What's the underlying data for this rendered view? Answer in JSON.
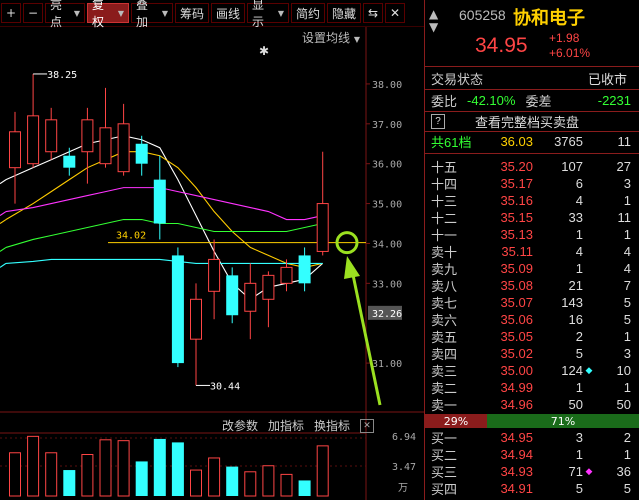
{
  "toolbar": {
    "items": [
      {
        "label": "+"
      },
      {
        "label": "−"
      },
      {
        "label": "亮点",
        "arrow": true
      },
      {
        "label": "复权",
        "arrow": true,
        "active": true
      },
      {
        "label": "叠加",
        "arrow": true
      },
      {
        "label": "筹码"
      },
      {
        "label": "画线"
      },
      {
        "label": "显示",
        "arrow": true
      },
      {
        "label": "简约"
      },
      {
        "label": "隐藏"
      },
      {
        "label": "⇆"
      },
      {
        "label": "✕"
      }
    ]
  },
  "chart": {
    "settings_link": "设置均线",
    "settings_arrow": "▼",
    "star": "✱",
    "price_axis": [
      "38.00",
      "37.00",
      "36.00",
      "35.00",
      "34.00",
      "33.00",
      "32.26",
      "31.00"
    ],
    "high_label": "38.25",
    "low_label": "30.44",
    "line_label": "34.02",
    "vol_axis": [
      "6.94",
      "3.47"
    ],
    "volume_unit": "万",
    "ind_links": [
      "改参数",
      "加指标",
      "换指标"
    ],
    "ind_close": "✕"
  },
  "chart_data": {
    "type": "candlestick",
    "candles": [
      {
        "o": 35.9,
        "c": 36.8,
        "h": 37.3,
        "l": 35.0,
        "up": true
      },
      {
        "o": 36.0,
        "c": 37.2,
        "h": 38.25,
        "l": 35.9,
        "up": true
      },
      {
        "o": 36.3,
        "c": 37.1,
        "h": 37.4,
        "l": 36.1,
        "up": true
      },
      {
        "o": 35.9,
        "c": 36.2,
        "h": 36.4,
        "l": 35.7,
        "up": false
      },
      {
        "o": 36.3,
        "c": 37.1,
        "h": 37.4,
        "l": 35.5,
        "up": true
      },
      {
        "o": 36.0,
        "c": 36.9,
        "h": 37.9,
        "l": 35.9,
        "up": true
      },
      {
        "o": 35.8,
        "c": 37.0,
        "h": 37.5,
        "l": 35.7,
        "up": true
      },
      {
        "o": 36.5,
        "c": 36.0,
        "h": 36.7,
        "l": 35.7,
        "up": false
      },
      {
        "o": 35.6,
        "c": 34.5,
        "h": 36.2,
        "l": 34.1,
        "up": false
      },
      {
        "o": 33.7,
        "c": 31.0,
        "h": 33.9,
        "l": 30.9,
        "up": false
      },
      {
        "o": 31.6,
        "c": 32.6,
        "h": 33.0,
        "l": 30.44,
        "up": true
      },
      {
        "o": 32.8,
        "c": 33.6,
        "h": 34.1,
        "l": 32.1,
        "up": true
      },
      {
        "o": 33.2,
        "c": 32.2,
        "h": 33.4,
        "l": 32.0,
        "up": false
      },
      {
        "o": 32.3,
        "c": 33.0,
        "h": 33.5,
        "l": 31.6,
        "up": true
      },
      {
        "o": 32.6,
        "c": 33.2,
        "h": 33.3,
        "l": 31.9,
        "up": true
      },
      {
        "o": 33.0,
        "c": 33.4,
        "h": 33.6,
        "l": 32.8,
        "up": true
      },
      {
        "o": 33.0,
        "c": 33.7,
        "h": 33.9,
        "l": 32.8,
        "up": false
      },
      {
        "o": 33.8,
        "c": 35.0,
        "h": 36.3,
        "l": 33.7,
        "up": true
      }
    ],
    "ma": [
      {
        "name": "MA5",
        "color": "#ffffff",
        "values": [
          35.6,
          35.9,
          36.1,
          36.3,
          36.5,
          36.6,
          36.7,
          36.6,
          36.4,
          35.6,
          34.7,
          33.8,
          33.0,
          32.6,
          32.9,
          33.0,
          33.1,
          33.5
        ]
      },
      {
        "name": "MA10",
        "color": "#ffcc00",
        "values": [
          34.6,
          35.0,
          35.3,
          35.6,
          35.9,
          36.1,
          36.3,
          36.3,
          36.2,
          35.9,
          35.4,
          34.8,
          34.3,
          33.9,
          33.7,
          33.5,
          33.4,
          33.5
        ]
      },
      {
        "name": "MA20",
        "color": "#ff33ff",
        "values": [
          34.8,
          34.9,
          35.0,
          35.1,
          35.2,
          35.3,
          35.4,
          35.4,
          35.4,
          35.3,
          35.2,
          35.1,
          35.0,
          34.9,
          34.8,
          34.6,
          34.6,
          34.7
        ]
      },
      {
        "name": "MA30",
        "color": "#33ff33",
        "values": [
          33.9,
          34.1,
          34.2,
          34.3,
          34.4,
          34.5,
          34.6,
          34.6,
          34.5,
          34.5,
          34.4,
          34.3,
          34.3,
          34.3,
          34.3,
          34.3,
          34.4,
          34.5
        ]
      },
      {
        "name": "MA60",
        "color": "#33ffff",
        "values": [
          33.5,
          33.55,
          33.6,
          33.6,
          33.6,
          33.6,
          33.6,
          33.6,
          33.6,
          33.55,
          33.5,
          33.5,
          33.5,
          33.5,
          33.5,
          33.5,
          33.5,
          33.5
        ]
      }
    ],
    "volumes": [
      5.0,
      6.9,
      5.0,
      3.0,
      4.8,
      6.5,
      6.4,
      4.0,
      6.6,
      6.2,
      3.0,
      4.4,
      3.4,
      2.8,
      3.5,
      2.5,
      1.8,
      5.8
    ],
    "y_range": [
      30.2,
      38.6
    ],
    "vol_range": [
      0,
      6.94
    ]
  },
  "quote": {
    "code": "605258",
    "name": "协和电子",
    "price": "34.95",
    "change": "+1.98",
    "pct": "+6.01%",
    "status_label": "交易状态",
    "status_value": "已收市",
    "weibi_label": "委比",
    "weibi_value": "-42.10%",
    "weicha_label": "委差",
    "weicha_value": "-2231",
    "full_book_q": "?",
    "full_book_label": "查看完整档买卖盘",
    "total_label": "共61档",
    "total_price": "36.03",
    "total_vol": "3765",
    "total_n": "11",
    "sells": [
      {
        "label": "十五",
        "price": "35.20",
        "vol": "107",
        "n": "27"
      },
      {
        "label": "十四",
        "price": "35.17",
        "vol": "6",
        "n": "3"
      },
      {
        "label": "十三",
        "price": "35.16",
        "vol": "4",
        "n": "1"
      },
      {
        "label": "十二",
        "price": "35.15",
        "vol": "33",
        "n": "11"
      },
      {
        "label": "十一",
        "price": "35.13",
        "vol": "1",
        "n": "1"
      },
      {
        "label": "卖十",
        "price": "35.11",
        "vol": "4",
        "n": "4"
      },
      {
        "label": "卖九",
        "price": "35.09",
        "vol": "1",
        "n": "4"
      },
      {
        "label": "卖八",
        "price": "35.08",
        "vol": "21",
        "n": "7"
      },
      {
        "label": "卖七",
        "price": "35.07",
        "vol": "143",
        "n": "5"
      },
      {
        "label": "卖六",
        "price": "35.06",
        "vol": "16",
        "n": "5"
      },
      {
        "label": "卖五",
        "price": "35.05",
        "vol": "2",
        "n": "1"
      },
      {
        "label": "卖四",
        "price": "35.02",
        "vol": "5",
        "n": "3"
      },
      {
        "label": "卖三",
        "price": "35.00",
        "vol": "124",
        "n": "10",
        "mark": "◆",
        "markColor": "#33ffff"
      },
      {
        "label": "卖二",
        "price": "34.99",
        "vol": "1",
        "n": "1"
      },
      {
        "label": "卖一",
        "price": "34.96",
        "vol": "50",
        "n": "50"
      }
    ],
    "ratio_left": "29%",
    "ratio_right": "71%",
    "ratio_split": 0.29,
    "buys": [
      {
        "label": "买一",
        "price": "34.95",
        "vol": "3",
        "n": "2"
      },
      {
        "label": "买二",
        "price": "34.94",
        "vol": "1",
        "n": "1"
      },
      {
        "label": "买三",
        "price": "34.93",
        "vol": "71",
        "n": "36",
        "mark": "◆",
        "markColor": "#ff33ff"
      },
      {
        "label": "买四",
        "price": "34.91",
        "vol": "5",
        "n": "5"
      }
    ]
  }
}
